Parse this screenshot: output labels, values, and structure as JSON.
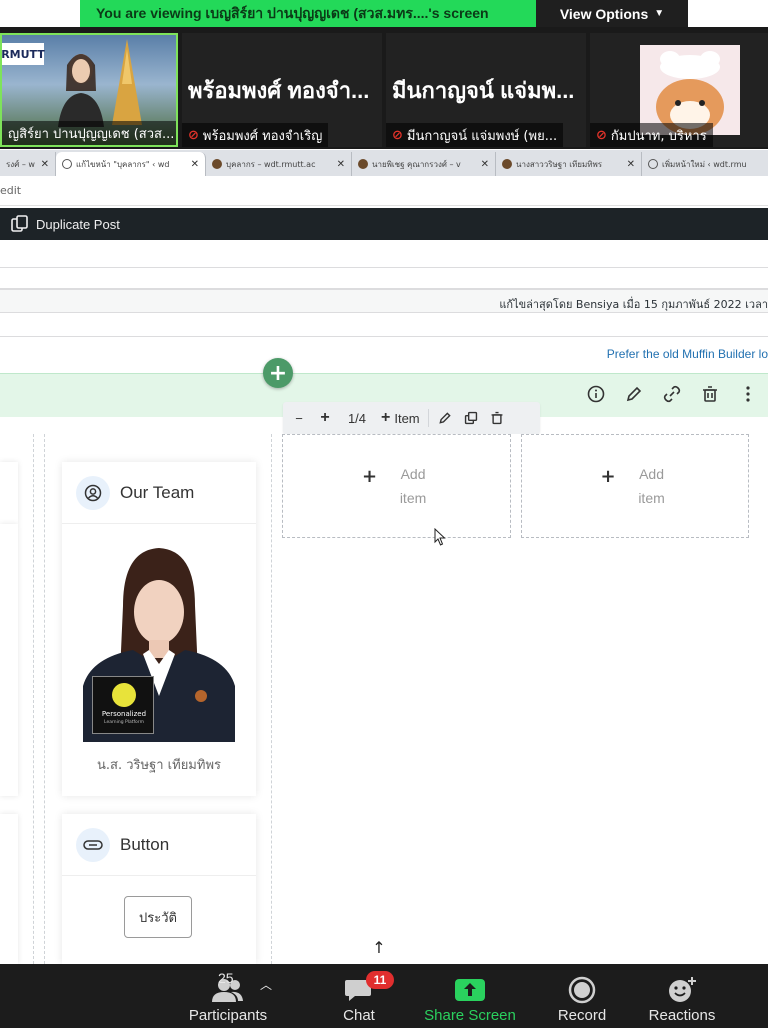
{
  "zoom_banner": {
    "message": "You are viewing เบญสิร์ยา ปานปุญญเดช (สวส.มทร....'s screen",
    "view_options_label": "View Options"
  },
  "participants_strip": [
    {
      "big_name": "",
      "name": "ญสิร์ยา ปานปุญญเดช (สวส..."
    },
    {
      "big_name": "พร้อมพงศ์ ทองจำ...",
      "name": "พร้อมพงศ์ ทองจำเริญ"
    },
    {
      "big_name": "มีนกาญจน์ แจ่มพ...",
      "name": "มีนกาญจน์ แจ่มพงษ์ (พย..."
    },
    {
      "big_name": "",
      "name": "กัมปนาท, บริหาร"
    }
  ],
  "presenter_logo_text": "RMUTT",
  "browser": {
    "tabs": [
      {
        "label": "รงศ์ – w",
        "active": false
      },
      {
        "label": "แก้ไขหน้า \"บุคลากร\" ‹ wd",
        "active": true
      },
      {
        "label": "บุคลากร – wdt.rmutt.ac",
        "active": false
      },
      {
        "label": "นายพิเชฐ คุณากรวงศ์ – v",
        "active": false
      },
      {
        "label": "นางสาววริษฐา เทียมทิพร",
        "active": false
      },
      {
        "label": "เพิ่มหน้าใหม่ ‹ wdt.rmu",
        "active": false
      }
    ],
    "url_fragment": "edit"
  },
  "wp_toolbar": {
    "duplicate_label": "Duplicate Post"
  },
  "status_text": "แก้ไขล่าสุดโดย Bensiya เมื่อ 15 กุมภาพันธ์ 2022 เวลา",
  "muffin_link": "Prefer the old Muffin Builder lo",
  "wrap_toolbar": {
    "fraction": "1/4",
    "item_label": "Item"
  },
  "cards": {
    "team": {
      "title": "Our Team",
      "caption": "น.ส. วริษฐา เทียมทิพร"
    },
    "button": {
      "title": "Button",
      "button_label": "ประวัติ"
    }
  },
  "photo_logo": {
    "line1": "Personalized",
    "line2": "Learning Platform"
  },
  "placeholders": [
    {
      "line1": "Add",
      "line2": "item"
    },
    {
      "line1": "Add",
      "line2": "item"
    }
  ],
  "zoom_toolbar": {
    "participants_label": "Participants",
    "participants_count": "25",
    "chat_label": "Chat",
    "chat_badge": "11",
    "share_label": "Share Screen",
    "record_label": "Record",
    "reactions_label": "Reactions"
  },
  "colors": {
    "banner_green": "#23d959",
    "section_green": "#e3f6e8",
    "add_button": "#4c9a68",
    "link_blue": "#2271b1",
    "wp_bar": "#1d2327"
  }
}
